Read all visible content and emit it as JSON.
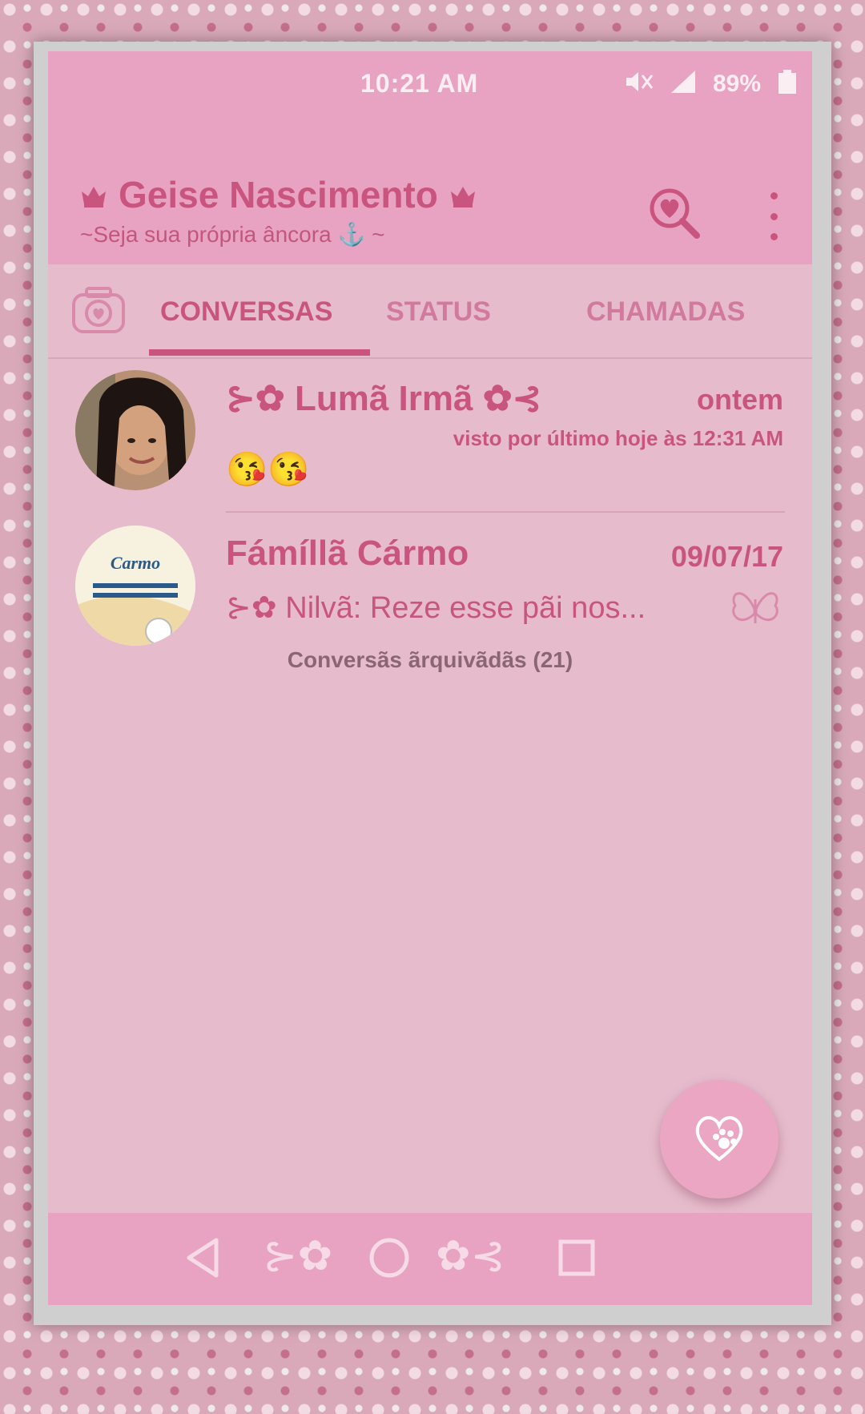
{
  "status_bar": {
    "time": "10:21 AM",
    "battery": "89%",
    "icons": [
      "mute-icon",
      "signal-icon",
      "battery-icon"
    ]
  },
  "header": {
    "title": "Geise Nascimento",
    "subtitle": "~Seja sua própria âncora",
    "subtitle_suffix": "~",
    "icons": [
      "crown-icon",
      "heart-search-icon",
      "more-vert-icon",
      "anchor-icon"
    ]
  },
  "tabs": [
    {
      "label": "CONVERSAS",
      "selected": true
    },
    {
      "label": "STATUS",
      "selected": false
    },
    {
      "label": "CHAMADAS",
      "selected": false
    }
  ],
  "chats": [
    {
      "name": "Lumã Irmã",
      "date": "ontem",
      "subline": "visto por último hoje às 12:31 AM",
      "preview": "😘😘"
    },
    {
      "name": "Fámíllã Cármo",
      "date": "09/07/17",
      "preview": "Nilvã: Reze esse pãi nos...",
      "avatar_text": "Carmo"
    }
  ],
  "archived_label": "Conversãs ãrquivãdãs (21)",
  "colors": {
    "accent": "#c9557f",
    "bar": "#e9a3c2",
    "background": "#e6bccc"
  }
}
